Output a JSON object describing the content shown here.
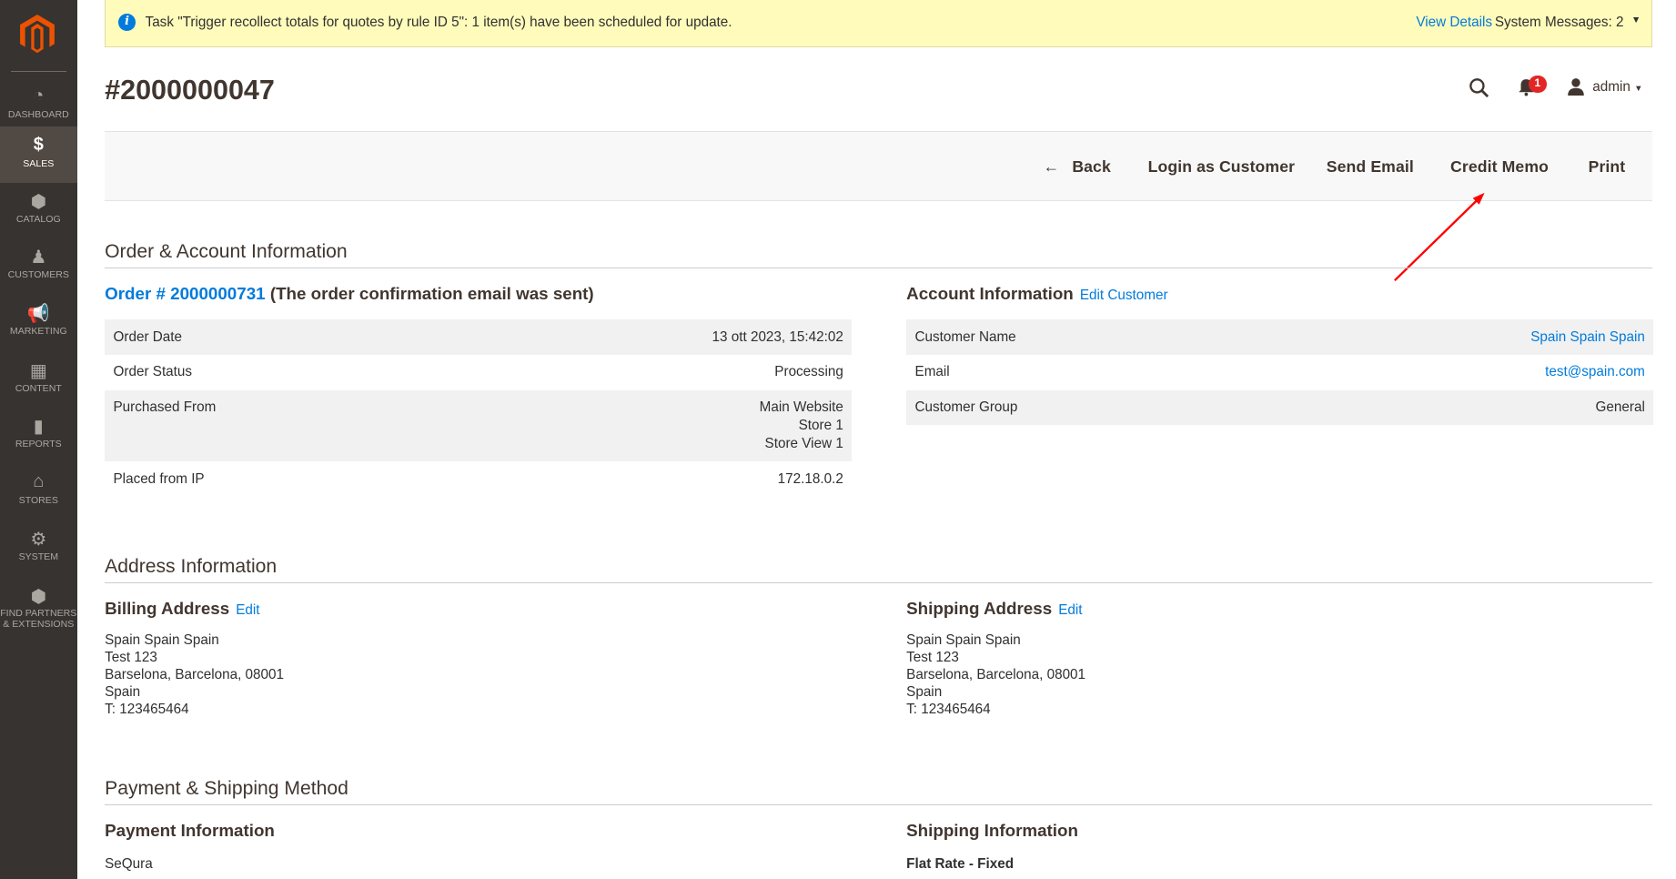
{
  "sidebar": {
    "items": [
      {
        "label": "Dashboard",
        "icon": "dashboard-icon"
      },
      {
        "label": "Sales",
        "icon": "dollar-icon",
        "active": true
      },
      {
        "label": "Catalog",
        "icon": "box-icon"
      },
      {
        "label": "Customers",
        "icon": "person-icon"
      },
      {
        "label": "Marketing",
        "icon": "megaphone-icon"
      },
      {
        "label": "Content",
        "icon": "layout-icon"
      },
      {
        "label": "Reports",
        "icon": "bar-chart-icon"
      },
      {
        "label": "Stores",
        "icon": "store-icon"
      },
      {
        "label": "System",
        "icon": "gear-icon"
      },
      {
        "label": "Find Partners & Extensions",
        "icon": "cubes-icon"
      }
    ]
  },
  "notice": {
    "message": "Task \"Trigger recollect totals for quotes by rule ID 5\": 1 item(s) have been scheduled for update.",
    "view_details": "View Details",
    "system_messages": "System Messages: 2"
  },
  "header": {
    "title": "#2000000047",
    "notifications": "1",
    "user": "admin"
  },
  "actions": {
    "back": "Back",
    "login": "Login as Customer",
    "email": "Send Email",
    "credit_memo": "Credit Memo",
    "print": "Print"
  },
  "order_account": {
    "section": "Order & Account Information",
    "order_link": "Order # 2000000731",
    "order_note": "(The order confirmation email was sent)",
    "order_rows": [
      {
        "k": "Order Date",
        "v": "13 ott 2023, 15:42:02"
      },
      {
        "k": "Order Status",
        "v": "Processing"
      },
      {
        "k": "Purchased From",
        "v": [
          "Main Website",
          "Store 1",
          "Store View 1"
        ]
      },
      {
        "k": "Placed from IP",
        "v": "172.18.0.2"
      }
    ],
    "account_title": "Account Information",
    "edit_customer": "Edit Customer",
    "account_rows": [
      {
        "k": "Customer Name",
        "v": "Spain Spain Spain"
      },
      {
        "k": "Email",
        "v": "test@spain.com"
      },
      {
        "k": "Customer Group",
        "v": "General"
      }
    ]
  },
  "address": {
    "section": "Address Information",
    "billing_title": "Billing Address",
    "shipping_title": "Shipping Address",
    "edit": "Edit",
    "billing": [
      "Spain Spain Spain",
      "Test 123",
      "Barselona, Barcelona, 08001",
      "Spain",
      "T: 123465464"
    ],
    "shipping": [
      "Spain Spain Spain",
      "Test 123",
      "Barselona, Barcelona, 08001",
      "Spain",
      "T: 123465464"
    ]
  },
  "payment": {
    "section": "Payment & Shipping Method",
    "payment_title": "Payment Information",
    "payment_method": "SeQura",
    "shipping_title": "Shipping Information",
    "shipping_method": "Flat Rate - Fixed"
  },
  "colors": {
    "sidebar": "#373330",
    "active": "#514943",
    "link": "#007bdb",
    "notice": "#fffbbb",
    "annotation_arrow": "#ff0000"
  }
}
